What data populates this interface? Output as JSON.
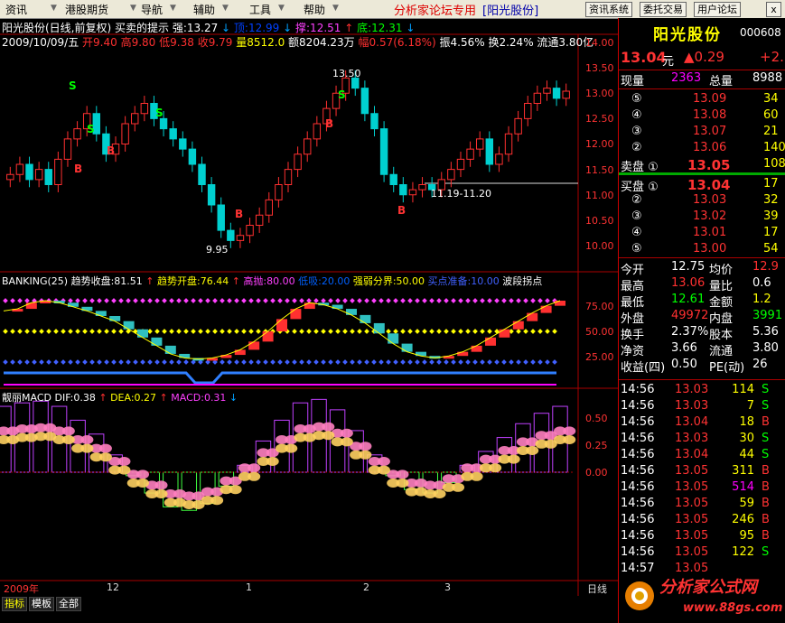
{
  "menu": {
    "items": [
      "资讯",
      "港股期货",
      "导航",
      "辅助",
      "工具",
      "帮助"
    ],
    "brand": "分析家论坛专用",
    "brand_stock": "[阳光股份]",
    "buttons": [
      "资讯系统",
      "委托交易",
      "用户论坛"
    ],
    "close": "x"
  },
  "header": {
    "line1_name": "阳光股份(日线,前复权) 买卖的提示",
    "line1_items": [
      {
        "label": "强:13.27",
        "color": "#ffffff"
      },
      {
        "label": "↓",
        "color": "#00a0ff"
      },
      {
        "label": "顶:12.99",
        "color": "#0040ff"
      },
      {
        "label": "↓",
        "color": "#00a0ff"
      },
      {
        "label": "撑:12.51",
        "color": "#ff40ff"
      },
      {
        "label": "↑",
        "color": "#ff3030"
      },
      {
        "label": "底:12.31",
        "color": "#00ff00"
      },
      {
        "label": "↓",
        "color": "#00a0ff"
      }
    ],
    "line2": "2009/10/09/五",
    "line2_items": [
      {
        "label": "开9.40",
        "color": "#ff3030"
      },
      {
        "label": "高9.80",
        "color": "#ff3030"
      },
      {
        "label": "低9.38",
        "color": "#ff3030"
      },
      {
        "label": "收9.79",
        "color": "#ff3030"
      },
      {
        "label": "量8512.0",
        "color": "#ffff00"
      },
      {
        "label": "额8204.23万",
        "color": "#ffffff"
      },
      {
        "label": "幅0.57(6.18%)",
        "color": "#ff3030"
      },
      {
        "label": "振4.56%",
        "color": "#ffffff"
      },
      {
        "label": "换2.24%",
        "color": "#ffffff"
      },
      {
        "label": "流通3.80亿",
        "color": "#ffffff"
      }
    ]
  },
  "price_axis": [
    "14.00",
    "13.50",
    "13.00",
    "12.50",
    "12.00",
    "11.50",
    "11.00",
    "10.50",
    "10.00"
  ],
  "annotations": {
    "high": "13.50",
    "low": "9.95",
    "range": "11.19-11.20",
    "signals": [
      "S",
      "S",
      "S",
      "S",
      "B",
      "B",
      "B",
      "B",
      "B"
    ]
  },
  "banking": {
    "title": "BANKING(25)",
    "items": [
      {
        "label": "趋势收盘:81.51",
        "color": "#ffffff"
      },
      {
        "label": "↑",
        "color": "#ff3030"
      },
      {
        "label": "趋势开盘:76.44",
        "color": "#ffff00"
      },
      {
        "label": "↑",
        "color": "#ff3030"
      },
      {
        "label": "高抛:80.00",
        "color": "#ff40ff"
      },
      {
        "label": "低吸:20.00",
        "color": "#0060ff"
      },
      {
        "label": "强弱分界:50.00",
        "color": "#ffff00"
      },
      {
        "label": "买点准备:10.00",
        "color": "#4060ff"
      },
      {
        "label": "波段拐点",
        "color": "#ffffff"
      }
    ],
    "axis": [
      "75.00",
      "50.00",
      "25.00"
    ]
  },
  "macd": {
    "title": "靓丽MACD",
    "items": [
      {
        "label": "DIF:0.38",
        "color": "#ffffff"
      },
      {
        "label": "↑",
        "color": "#ff3030"
      },
      {
        "label": "DEA:0.27",
        "color": "#ffff00"
      },
      {
        "label": "↑",
        "color": "#ff3030"
      },
      {
        "label": "MACD:0.31",
        "color": "#ff40ff"
      },
      {
        "label": "↓",
        "color": "#00a0ff"
      }
    ],
    "axis": [
      "0.50",
      "0.25",
      "0.00"
    ]
  },
  "time_axis": [
    "2009年",
    "12",
    "1",
    "2",
    "3"
  ],
  "time_axis_right": "日线",
  "tabs": [
    "指标",
    "模板",
    "全部"
  ],
  "quote": {
    "name": "阳光股份",
    "code": "000608",
    "price": "13.04",
    "unit": "元",
    "change": "▲0.29",
    "change2": "+2.",
    "vol_label": "现量",
    "vol": "2363",
    "total_label": "总量",
    "total": "8988",
    "sell": [
      {
        "level": "⑤",
        "price": "13.09",
        "vol": "34"
      },
      {
        "level": "④",
        "price": "13.08",
        "vol": "60"
      },
      {
        "level": "③",
        "price": "13.07",
        "vol": "21"
      },
      {
        "level": "②",
        "price": "13.06",
        "vol": "140"
      },
      {
        "level": "卖盘 ①",
        "price": "13.05",
        "vol": "108"
      }
    ],
    "buy": [
      {
        "level": "买盘 ①",
        "price": "13.04",
        "vol": "17"
      },
      {
        "level": "②",
        "price": "13.03",
        "vol": "32"
      },
      {
        "level": "③",
        "price": "13.02",
        "vol": "39"
      },
      {
        "level": "④",
        "price": "13.01",
        "vol": "17"
      },
      {
        "level": "⑤",
        "price": "13.00",
        "vol": "54"
      }
    ],
    "stats": [
      {
        "l1": "今开",
        "v1": "12.75",
        "c1": "#ffffff",
        "l2": "均价",
        "v2": "12.9",
        "c2": "#ff3030"
      },
      {
        "l1": "最高",
        "v1": "13.06",
        "c1": "#ff3030",
        "l2": "量比",
        "v2": "0.6",
        "c2": "#ffffff"
      },
      {
        "l1": "最低",
        "v1": "12.61",
        "c1": "#00ff00",
        "l2": "金额",
        "v2": "1.2",
        "c2": "#ffff00"
      },
      {
        "l1": "外盘",
        "v1": "49972",
        "c1": "#ff3030",
        "l2": "内盘",
        "v2": "3991",
        "c2": "#00ff00"
      },
      {
        "l1": "换手",
        "v1": "2.37%",
        "c1": "#ffffff",
        "l2": "股本",
        "v2": "5.36",
        "c2": "#ffffff"
      },
      {
        "l1": "净资",
        "v1": "3.66",
        "c1": "#ffffff",
        "l2": "流通",
        "v2": "3.80",
        "c2": "#ffffff"
      },
      {
        "l1": "收益(四)",
        "v1": "0.50",
        "c1": "#ffffff",
        "l2": "PE(动)",
        "v2": "26",
        "c2": "#ffffff"
      }
    ],
    "ticks": [
      {
        "t": "14:56",
        "p": "13.03",
        "v": "114",
        "s": "S"
      },
      {
        "t": "14:56",
        "p": "13.03",
        "v": "7",
        "s": "S"
      },
      {
        "t": "14:56",
        "p": "13.04",
        "v": "18",
        "s": "B"
      },
      {
        "t": "14:56",
        "p": "13.03",
        "v": "30",
        "s": "S"
      },
      {
        "t": "14:56",
        "p": "13.04",
        "v": "44",
        "s": "S"
      },
      {
        "t": "14:56",
        "p": "13.05",
        "v": "311",
        "s": "B"
      },
      {
        "t": "14:56",
        "p": "13.05",
        "v": "514",
        "s": "B"
      },
      {
        "t": "14:56",
        "p": "13.05",
        "v": "59",
        "s": "B"
      },
      {
        "t": "14:56",
        "p": "13.05",
        "v": "246",
        "s": "B"
      },
      {
        "t": "14:56",
        "p": "13.05",
        "v": "95",
        "s": "B"
      },
      {
        "t": "14:56",
        "p": "13.05",
        "v": "122",
        "s": "S"
      },
      {
        "t": "14:57",
        "p": "13.05",
        "v": "",
        "s": ""
      }
    ]
  },
  "logo": {
    "text": "分析家公式网",
    "url": "www.88gs.com"
  },
  "chart_data": {
    "type": "line",
    "candles_close_approx": [
      11.4,
      11.6,
      11.3,
      11.5,
      11.2,
      11.7,
      12.1,
      12.3,
      12.6,
      12.2,
      11.8,
      12.0,
      12.4,
      12.6,
      12.8,
      12.5,
      12.3,
      12.1,
      11.9,
      11.6,
      11.2,
      10.8,
      10.3,
      10.1,
      10.2,
      10.4,
      10.6,
      10.9,
      11.2,
      11.5,
      11.8,
      12.1,
      12.4,
      12.7,
      13.0,
      13.3,
      13.1,
      12.6,
      12.3,
      11.4,
      11.2,
      11.0,
      11.1,
      11.2,
      11.1,
      11.3,
      11.5,
      11.7,
      11.9,
      12.1,
      11.6,
      11.8,
      12.2,
      12.5,
      12.8,
      13.0,
      13.1,
      12.9,
      13.04
    ],
    "ylim": [
      9.8,
      14.2
    ],
    "banking_series": [
      70,
      72,
      78,
      80,
      78,
      74,
      70,
      65,
      60,
      52,
      44,
      36,
      28,
      24,
      23,
      24,
      27,
      32,
      40,
      50,
      62,
      72,
      78,
      76,
      72,
      66,
      58,
      48,
      38,
      30,
      26,
      24,
      26,
      30,
      36,
      44,
      52,
      60,
      68,
      75,
      80
    ],
    "macd_dif": [
      0.38,
      0.4,
      0.41,
      0.38,
      0.3,
      0.22,
      0.1,
      -0.02,
      -0.12,
      -0.2,
      -0.22,
      -0.18,
      -0.08,
      0.04,
      0.18,
      0.3,
      0.4,
      0.42,
      0.36,
      0.24,
      0.1,
      -0.02,
      -0.1,
      -0.12,
      -0.06,
      0.04,
      0.12,
      0.2,
      0.28,
      0.34,
      0.38
    ]
  }
}
